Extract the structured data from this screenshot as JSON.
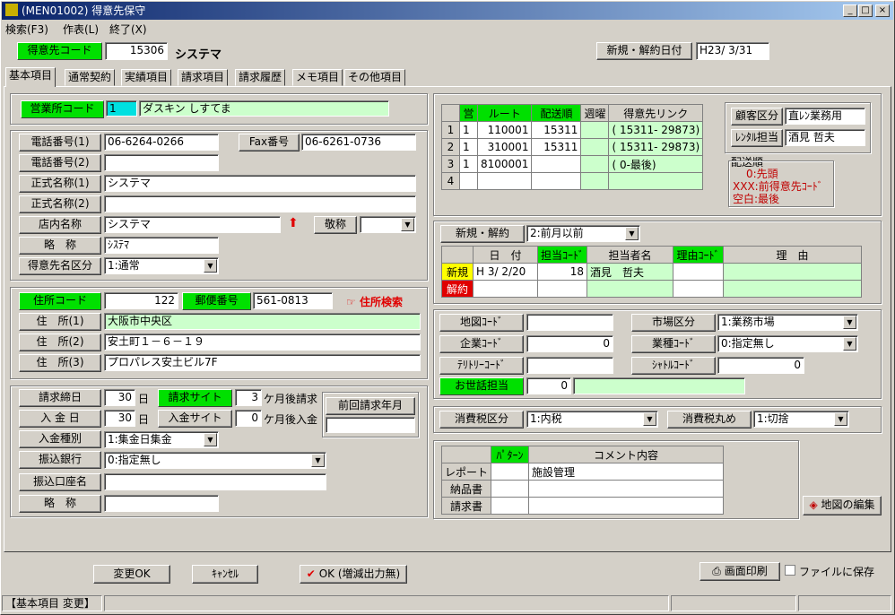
{
  "title": "(MEN01002) 得意先保守",
  "menu": [
    "検索(F3)",
    "作表(L)",
    "終了(X)"
  ],
  "header": {
    "code_label": "得意先コード",
    "code_value": "15306",
    "name": "システマ",
    "date_label": "新規・解約日付",
    "date_value": "H23/ 3/31"
  },
  "tabs": [
    "基本項目",
    "通常契約",
    "実績項目",
    "請求項目",
    "請求履歴",
    "メモ項目",
    "その他項目"
  ],
  "office": {
    "label": "営業所コード",
    "code": "1",
    "name": "ダスキン しすてま"
  },
  "contact": {
    "tel1_label": "電話番号(1)",
    "tel1": "06-6264-0266",
    "fax_label": "Fax番号",
    "fax": "06-6261-0736",
    "tel2_label": "電話番号(2)",
    "tel2": "",
    "formal1_label": "正式名称(1)",
    "formal1": "システマ",
    "formal2_label": "正式名称(2)",
    "formal2": "",
    "store_label": "店内名称",
    "store": "システマ",
    "honor_label": "敬称",
    "honor": "",
    "abbr_label": "略　称",
    "abbr": "ｼｽﾃﾏ",
    "kind_label": "得意先名区分",
    "kind": "1:通常"
  },
  "address": {
    "code_label": "住所コード",
    "code": "122",
    "zip_label": "郵便番号",
    "zip": "561-0813",
    "search_label": "住所検索",
    "a1_label": "住　所(1)",
    "a1": "大阪市中央区",
    "a2_label": "住　所(2)",
    "a2": "安土町１－６－１９",
    "a3_label": "住　所(3)",
    "a3": "プロパレス安土ビル7F"
  },
  "billing": {
    "close_label": "請求締日",
    "close": "30",
    "day": "日",
    "site_label": "請求サイト",
    "site": "3",
    "site_suffix": "ケ月後請求",
    "pay_label": "入 金 日",
    "pay": "30",
    "paysite_label": "入金サイト",
    "paysite": "0",
    "paysite_suffix": "ケ月後入金",
    "prev_label": "前回請求年月",
    "prev": "",
    "type_label": "入金種別",
    "type": "1:集金日集金",
    "bank_label": "振込銀行",
    "bank": "0:指定無し",
    "acct_label": "振込口座名",
    "acct": "",
    "abbr_label": "略　称",
    "abbr": ""
  },
  "route": {
    "headers": [
      "",
      "営",
      "ルート",
      "配送順",
      "週曜",
      "得意先リンク"
    ],
    "rows": [
      [
        "1",
        "1",
        "110001",
        "15311",
        "",
        "( 15311- 29873)"
      ],
      [
        "2",
        "1",
        "310001",
        "15311",
        "",
        "( 15311- 29873)"
      ],
      [
        "3",
        "1",
        "8100001",
        "",
        "",
        "(     0-最後)"
      ],
      [
        "4",
        "",
        "",
        "",
        "",
        ""
      ]
    ]
  },
  "customer": {
    "kind_label": "顧客区分",
    "kind": "直ﾚﾝ業務用",
    "rental_label": "ﾚﾝﾀﾙ担当",
    "rental": "酒見 哲夫",
    "order_title": "配送順",
    "order_notes": [
      "0:先頭",
      "XXX:前得意先ｺｰﾄﾞ",
      "空白:最後"
    ]
  },
  "contract": {
    "label": "新規・解約",
    "value": "2:前月以前",
    "headers": [
      "",
      "日　付",
      "担当ｺｰﾄﾞ",
      "担当者名",
      "理由ｺｰﾄﾞ",
      "理　由"
    ],
    "rows": [
      [
        "新規",
        "H 3/ 2/20",
        "18",
        "酒見　哲夫",
        "",
        ""
      ],
      [
        "解約",
        "",
        "",
        "",
        "",
        ""
      ]
    ]
  },
  "market": {
    "map_label": "地図ｺｰﾄﾞ",
    "map": "",
    "market_label": "市場区分",
    "market": "1:業務市場",
    "company_label": "企業ｺｰﾄﾞ",
    "company": "0",
    "industry_label": "業種ｺｰﾄﾞ",
    "industry": "0:指定無し",
    "territory_label": "ﾃﾘﾄﾘｰｺｰﾄﾞ",
    "territory": "",
    "shuttle_label": "ｼｬﾄﾙｺｰﾄﾞ",
    "shuttle": "0",
    "care_label": "お世話担当",
    "care": "0",
    "care_name": ""
  },
  "tax": {
    "kind_label": "消費税区分",
    "kind": "1:内税",
    "round_label": "消費税丸め",
    "round": "1:切捨"
  },
  "comment": {
    "headers": [
      "",
      "ﾊﾟﾀｰﾝ",
      "コメント内容"
    ],
    "rows": [
      [
        "レポート",
        "",
        "施設管理"
      ],
      [
        "納品書",
        "",
        ""
      ],
      [
        "請求書",
        "",
        ""
      ]
    ]
  },
  "map_edit": "地図の編集",
  "footer": {
    "change": "変更OK",
    "cancel": "ｷｬﾝｾﾙ",
    "ok": "OK (増減出力無)",
    "print": "画面印刷",
    "save": "ファイルに保存"
  },
  "status": "【基本項目 変更】",
  "colors": {
    "green": "#00e000",
    "light_green": "#ccffcc",
    "title": "#0a246a"
  }
}
